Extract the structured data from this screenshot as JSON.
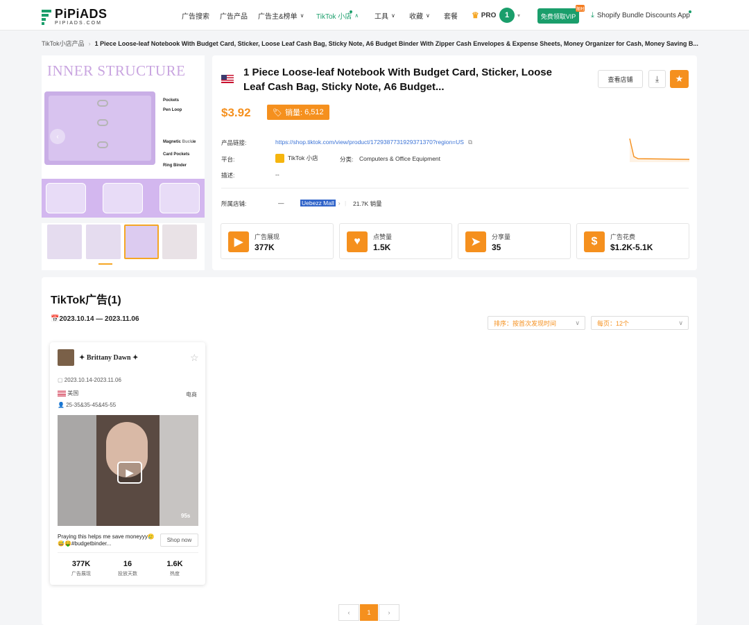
{
  "nav": {
    "logo_main": "PiPiADS",
    "logo_sub": "PIPIADS.COM",
    "items": [
      "广告搜索",
      "广告产品",
      "广告主&榜单",
      "TikTok 小店",
      "工具",
      "收藏",
      "套餐"
    ],
    "pro_label": "PRO",
    "avatar_number": "1",
    "vip_button": "免费领取VIP",
    "vip_tag": "限时",
    "shopify_label": "Shopify Bundle Discounts App",
    "accent_color": "#1a9e6b"
  },
  "breadcrumb": {
    "root": "TikTok小店产品",
    "current": "1 Piece Loose-leaf Notebook With Budget Card, Sticker, Loose Leaf Cash Bag, Sticky Note, A6 Budget Binder With Zipper Cash Envelopes & Expense Sheets, Money Organizer for Cash, Money Saving B..."
  },
  "gallery": {
    "heading": "INNER STRUCTURE",
    "callouts": [
      "Pockets",
      "Pen Loop",
      "Magnetic Buckle",
      "Card Pockets",
      "Ring Binder"
    ]
  },
  "product": {
    "title": "1 Piece Loose-leaf Notebook With Budget Card, Sticker, Loose Leaf Cash Bag, Sticky Note, A6 Budget...",
    "view_store_button": "查看店铺",
    "price": "$3.92",
    "sales_label": "销量:",
    "sales_value": "6,512",
    "link_label": "产品链接:",
    "link_value": "https://shop.tiktok.com/view/product/1729387731929371370?region=US",
    "platform_label": "平台:",
    "platform_value": "TikTok 小店",
    "category_label": "分类:",
    "category_value": "Computers & Office Equipment",
    "desc_label": "描述:",
    "desc_value": "--",
    "store_label": "所属店铺:",
    "store_dash": "—",
    "store_name": "Uebezz Mall",
    "store_sales": "21.7K 销量",
    "accent_color": "#f5901e"
  },
  "stats": [
    {
      "icon": "play-icon",
      "label": "广告展现",
      "value": "377K"
    },
    {
      "icon": "heart-icon",
      "label": "点赞量",
      "value": "1.5K"
    },
    {
      "icon": "send-icon",
      "label": "分享量",
      "value": "35"
    },
    {
      "icon": "dollar-icon",
      "label": "广告花费",
      "value": "$1.2K-5.1K"
    }
  ],
  "ads": {
    "title": "TikTok广告(1)",
    "date_range": "2023.10.14 — 2023.11.06",
    "sort_label": "排序：按首次发现时间",
    "per_page_label": "每页：12个",
    "card": {
      "author": "Brittany Dawn",
      "date": "2023.10.14-2023.11.06",
      "country": "美国",
      "tag": "电商",
      "ages": "25-35&35-45&45-55",
      "duration": "95s",
      "caption": "Praying this helps me save moneyyy🥲😅🤑#budgetbinder...",
      "shop_button": "Shop now",
      "metrics": [
        {
          "value": "377K",
          "label": "广告展现"
        },
        {
          "value": "16",
          "label": "投放天数"
        },
        {
          "value": "1.6K",
          "label": "热度"
        }
      ]
    },
    "pager": {
      "prev": "‹",
      "current": "1",
      "next": "›"
    }
  }
}
